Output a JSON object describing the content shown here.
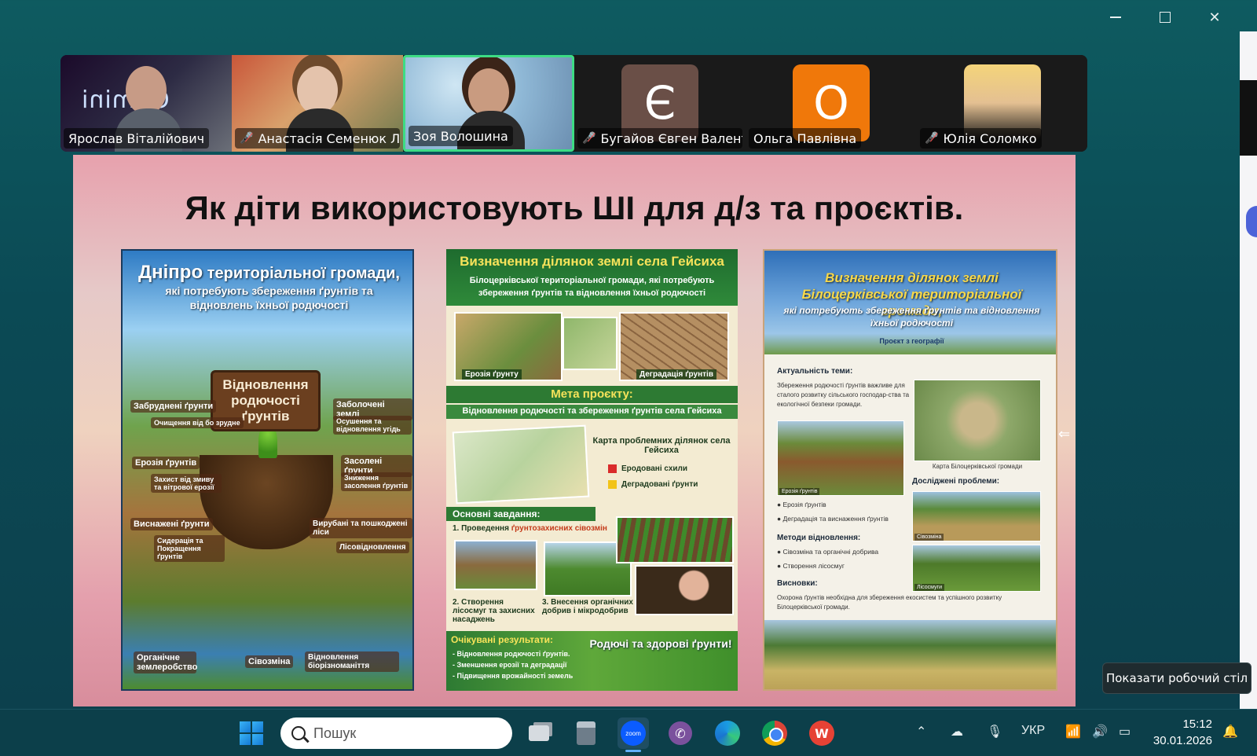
{
  "window": {
    "minimize": "─",
    "maximize": "□",
    "close": "✕"
  },
  "participants": [
    {
      "name": "Ярослав Віталійович",
      "muted": false,
      "type": "video",
      "overlay": "Gemini"
    },
    {
      "name": "Анастасія Семенюк Л...",
      "muted": true,
      "type": "video"
    },
    {
      "name": "Зоя Волошина",
      "muted": false,
      "type": "video",
      "active_speaker": true
    },
    {
      "name": "Бугайов Євген Валент...",
      "muted": true,
      "type": "avatar",
      "initial": "Є",
      "color": "#6a4f47"
    },
    {
      "name": "Ольга Павлівна",
      "muted": false,
      "type": "avatar",
      "initial": "О",
      "color": "#f0780a"
    },
    {
      "name": "Юлія Соломко",
      "muted": true,
      "type": "photo"
    }
  ],
  "slide": {
    "title": "Як діти використовують ШІ для д/з та проєктів.",
    "poster1": {
      "title_big": "Дніпро",
      "title_rest": " територіальної громади,",
      "subtitle": "які потребують збереження ґрунтів та відновлень їхньої родючості",
      "sign": "Відновлення родючості ґрунтів",
      "labels": [
        "Забруднені ґрунти",
        "Очищення від бо зрудне",
        "Заболочені землі",
        "Осушення та відновлення угідь",
        "Ерозія ґрунтів",
        "Захист від змиву та вітрової ерозії",
        "Засолені ґрунти",
        "Зниження засолення ґрунтів",
        "Виснажені ґрунти",
        "Сидерація та Покращення ґрунтів",
        "Вирубані та пошкоджені ліси",
        "Лісовідновлення",
        "Органічне землеробство",
        "Сівозміна",
        "Відновлення біорізноманіття"
      ]
    },
    "poster2": {
      "title": "Визначення ділянок землі села Гейсиха",
      "subtitle": "Білоцерківської територіальної громади, які потребують збереження ґрунтів та відновлення їхньої родючості",
      "photo1": "Ерозія ґрунту",
      "photo2": "Деградація ґрунтів",
      "goal_title": "Мета проєкту:",
      "goal_text": "Відновлення родючості та збереження ґрунтів села Гейсиха",
      "map_title": "Карта проблемних ділянок села Гейсиха",
      "legend": [
        {
          "label": "Еродовані схили",
          "color": "#d92b2b"
        },
        {
          "label": "Деградовані ґрунти",
          "color": "#f2c318"
        }
      ],
      "tasks_title": "Основні завдання:",
      "task1_pre": "1. Проведення ",
      "task1_em": "ґрунтозахисних сівозмін",
      "task2": "2. Створення лісосмуг та захисних насаджень",
      "task3": "3. Внесення органічних добрив і мікродобрив",
      "results_title": "Очікувані результати:",
      "results": [
        "- Відновлення родючості ґрунтів.",
        "- Зменшення ерозії та деградації",
        "- Підвищення врожайності земель"
      ],
      "slogan": "Родючі та здорові ґрунти!"
    },
    "poster3": {
      "title": "Визначення ділянок землі Білоцерківської територіальної громади,",
      "subtitle": "які потребують збереження ґрунтів та відновлення їхньої родючості",
      "project": "Проєкт з географії",
      "relevance_title": "Актуальність теми:",
      "relevance_text": "Збереження родючості ґрунтів важливе для сталого розвитку сільського господар-ства та екологічної безпеки громади.",
      "map_caption": "Карта Білоцерківської громади",
      "erosion_caption": "Ерозія ґрунтів",
      "problems_title": "Досліджені проблеми:",
      "problems": [
        "Ерозія ґрунтів",
        "Деградація та виснаження ґрунтів"
      ],
      "crop_caption": "Сівозміна",
      "methods_title": "Методи відновлення:",
      "methods": [
        "Сівозміна та органічні добрива",
        "Створення лісосмуг"
      ],
      "forest_caption": "Лісосмуги",
      "conclusions_title": "Висновки:",
      "conclusions_text": "Охорона ґрунтів необхідна для збереження екосистем та успішного розвитку Білоцерківської громади."
    }
  },
  "tooltip": "Показати робочий стіл",
  "taskbar": {
    "search_placeholder": "Пошук",
    "zoom_label": "zoom",
    "language": "УКР",
    "time": "15:12",
    "date": "30.01.2026"
  }
}
